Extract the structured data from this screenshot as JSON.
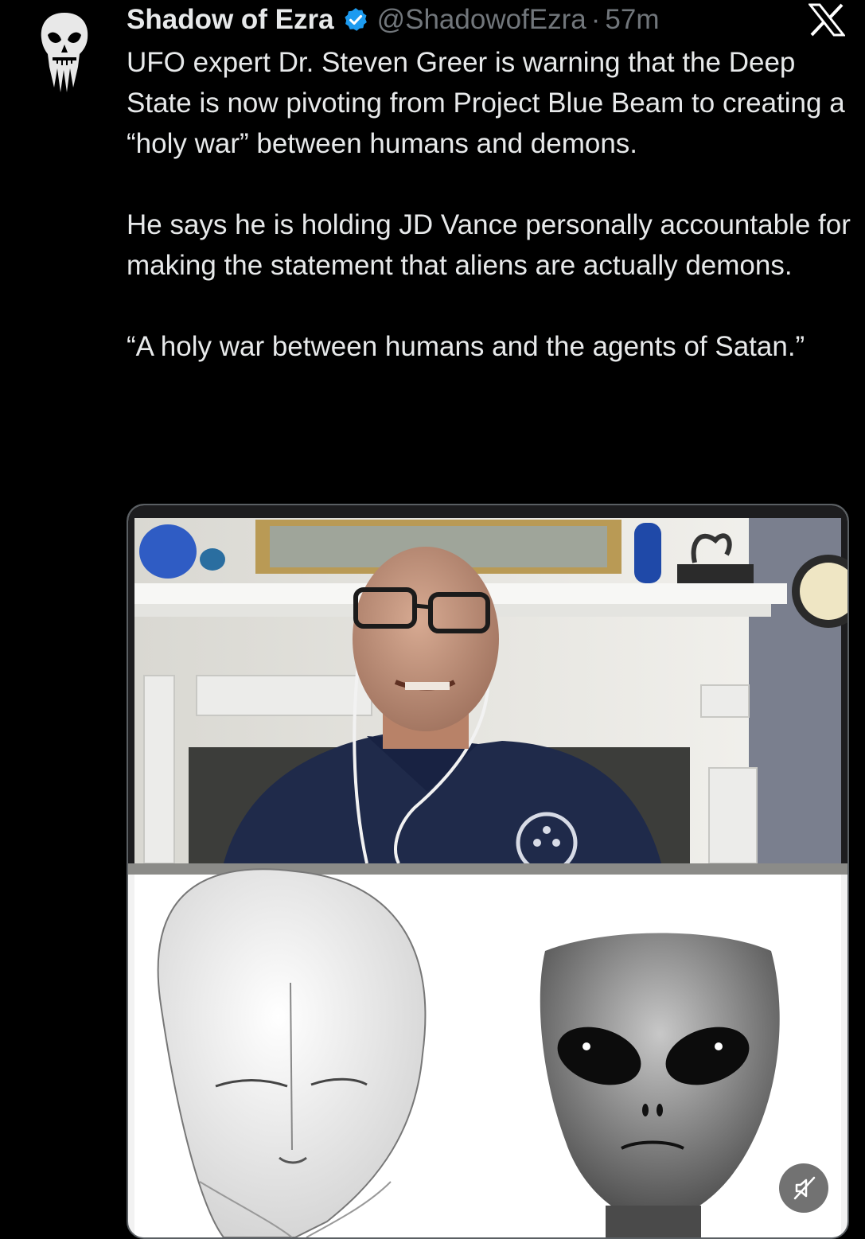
{
  "author": {
    "display_name": "Shadow of Ezra",
    "handle": "@ShadowofEzra",
    "separator": "·",
    "time_ago": "57m",
    "avatar_icon": "skull-avatar-icon",
    "verified_icon": "verified-badge-icon",
    "verified_color": "#1d9bf0"
  },
  "platform_icon": "x-logo-icon",
  "tweet": {
    "paragraphs": [
      "UFO expert Dr. Steven Greer is warning that the Deep State is now pivoting from Project Blue Beam to creating a “holy war” between humans and demons.",
      "He says he is holding JD Vance personally accountable for making the statement that aliens are actually demons.",
      "“A holy war between humans and the agents of Satan.”"
    ]
  },
  "media": {
    "mute_icon": "muted-speaker-icon"
  },
  "colors": {
    "background": "#000000",
    "text": "#e7e9ea",
    "secondary_text": "#71767b"
  }
}
